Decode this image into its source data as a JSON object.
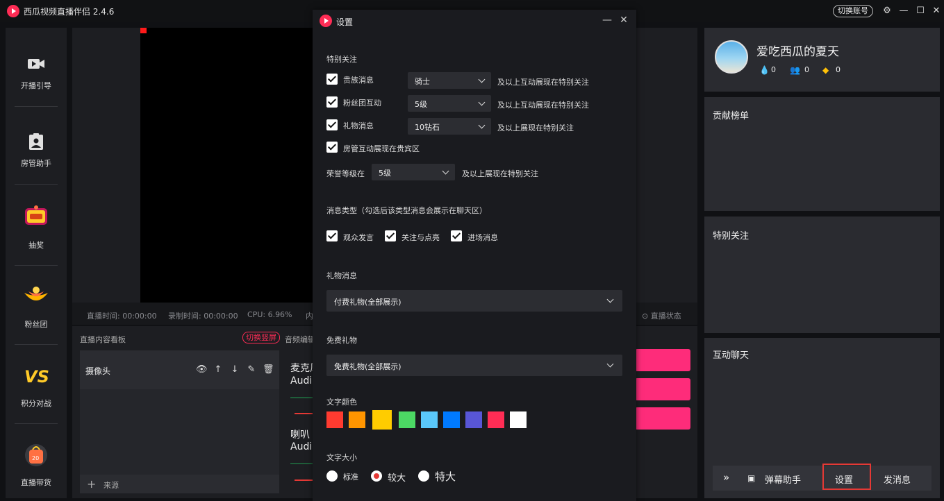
{
  "app": {
    "title": "西瓜视频直播伴侣 2.4.6",
    "switch_account": "切换账号"
  },
  "nav": [
    {
      "label": "开播引导",
      "icon": "video-camera-icon"
    },
    {
      "label": "房管助手",
      "icon": "badge-person-icon"
    },
    {
      "label": "抽奖",
      "icon": "lottery-icon"
    },
    {
      "label": "粉丝团",
      "icon": "fan-club-icon"
    },
    {
      "label": "积分对战",
      "icon": "vs-icon"
    },
    {
      "label": "直播带货",
      "icon": "shopping-bag-icon"
    }
  ],
  "status": {
    "live_time": "直播时间: 00:00:00",
    "record_time": "录制时间: 00:00:00",
    "cpu": "CPU: 6.96%",
    "mem": "内",
    "live_state": "直播状态"
  },
  "board": {
    "title": "直播内容看板",
    "switch_vertical": "切换竖屏",
    "audio_edit": "音频编辑",
    "source_name": "摄像头",
    "add_source": "来源",
    "mic_name": "麦克风",
    "mic_sub": "Audio",
    "speaker_name": "喇叭",
    "speaker_sub": "Audio"
  },
  "profile": {
    "name": "爱吃西瓜的夏天",
    "stat1": "0",
    "stat2": "0",
    "stat3": "0"
  },
  "right": {
    "rank_title": "贡献榜单",
    "special_title": "特别关注",
    "chat_title": "互动聊天",
    "danmu_helper": "弹幕助手",
    "settings": "设置",
    "send_msg": "发消息"
  },
  "dialog": {
    "title": "设置",
    "special_section": "特别关注",
    "noble_label": "贵族消息",
    "noble_value": "骑士",
    "noble_suffix": "及以上互动展现在特别关注",
    "fans_label": "粉丝团互动",
    "fans_value": "5级",
    "fans_suffix": "及以上互动展现在特别关注",
    "gift_label": "礼物消息",
    "gift_value": "10钻石",
    "gift_suffix": "及以上展现在特别关注",
    "admin_label": "房管互动展现在贵宾区",
    "honor_prefix": "荣誉等级在",
    "honor_value": "5级",
    "honor_suffix": "及以上展现在特别关注",
    "msg_type_section": "消息类型（勾选后该类型消息会展示在聊天区）",
    "msg_viewer": "观众发言",
    "msg_follow": "关注与点亮",
    "msg_enter": "进场消息",
    "gift_section": "礼物消息",
    "gift_select": "付费礼物(全部展示)",
    "free_section": "免费礼物",
    "free_select": "免费礼物(全部展示)",
    "color_section": "文字颜色",
    "colors": [
      "#ff3b30",
      "#ff9500",
      "#ffcc00",
      "#4cd964",
      "#5ac8fa",
      "#007aff",
      "#5856d6",
      "#ff2d55",
      "#ffffff"
    ],
    "selected_color": "#ffcc00",
    "size_section": "文字大小",
    "size_standard": "标准",
    "size_large": "较大",
    "size_xlarge": "特大",
    "size_selected": "较大"
  }
}
